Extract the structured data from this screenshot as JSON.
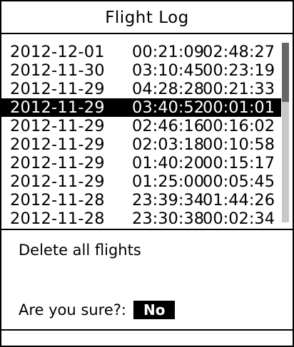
{
  "title": "Flight Log",
  "flights": [
    {
      "date": "2012-12-01",
      "start": "00:21:09",
      "duration": "02:48:27"
    },
    {
      "date": "2012-11-30",
      "start": "03:10:45",
      "duration": "00:23:19"
    },
    {
      "date": "2012-11-29",
      "start": "04:28:28",
      "duration": "00:21:33"
    },
    {
      "date": "2012-11-29",
      "start": "03:40:52",
      "duration": "00:01:01"
    },
    {
      "date": "2012-11-29",
      "start": "02:46:16",
      "duration": "00:16:02"
    },
    {
      "date": "2012-11-29",
      "start": "02:03:18",
      "duration": "00:10:58"
    },
    {
      "date": "2012-11-29",
      "start": "01:40:20",
      "duration": "00:15:17"
    },
    {
      "date": "2012-11-29",
      "start": "01:25:00",
      "duration": "00:05:45"
    },
    {
      "date": "2012-11-28",
      "start": "23:39:34",
      "duration": "01:44:26"
    },
    {
      "date": "2012-11-28",
      "start": "23:30:38",
      "duration": "00:02:34"
    }
  ],
  "selected_index": 3,
  "scroll_position": 0.0,
  "scroll_visible_fraction": 0.33,
  "action_label": "Delete all flights",
  "confirm_prompt": "Are you sure?:",
  "confirm_value": "No"
}
